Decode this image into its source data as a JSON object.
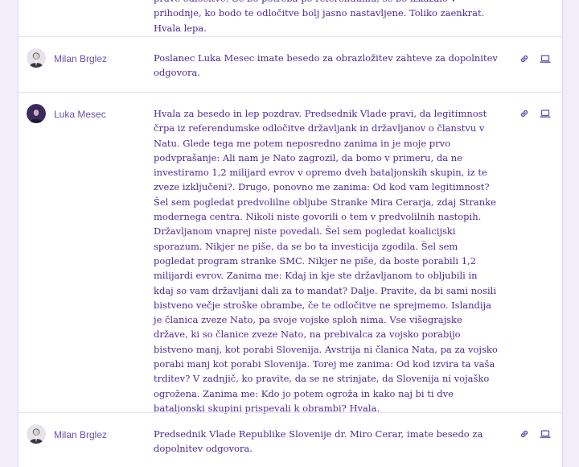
{
  "speeches": [
    {
      "speaker": "",
      "text": "prave odločitve.  Če bo potreba po referendumu, se bo izkazalo v prihodnje, ko bodo te odločitve bolj jasno nastavljene. Toliko zaenkrat. Hvala lepa."
    },
    {
      "speaker": "Milan Brglez",
      "text": "Poslanec Luka Mesec imate besedo za obrazložitev zahteve za dopolnitev odgovora."
    },
    {
      "speaker": "Luka Mesec",
      "text": "Hvala za besedo in lep pozdrav. Predsednik Vlade pravi, da legitimnost črpa iz referendumske odločitve državljank in državljanov o članstvu v Natu.  Glede tega me potem neposredno zanima in je moje prvo podvprašanje:  Ali nam je Nato zagrozil, da bomo v primeru, da ne investiramo 1,2 milijard evrov v opremo dveh bataljonskih skupin, iz te zveze izključeni?. Drugo, ponovno me zanima: Od kod vam legitimnost?  Šel sem pogledat predvolilne obljube Stranke Mira Cerarja, zdaj Stranke modernega centra. Nikoli niste govorili o tem v predvolilnih nastopih. Državljanom vnaprej niste povedali. Šel sem pogledat koalicijski sporazum. Nikjer ne piše, da se bo ta investicija zgodila. Šel sem pogledat program stranke SMC. Nikjer ne piše, da boste porabili 1,2 milijardi evrov. Zanima me:  Kdaj in kje ste državljanom to obljubili in kdaj so vam državljani dali za to mandat? Dalje. Pravite, da bi sami nosili bistveno večje stroške obrambe, če te odločitve ne sprejmemo. Islandija je članica zveze Nato, pa svoje vojske sploh nima. Vse višegrajske države, ki so članice zveze Nato, na prebivalca za vojsko porabijo bistveno manj, kot porabi Slovenija. Avstrija ni članica Nata, pa za vojsko porabi manj kot porabi Slovenija. Torej me zanima: Od kod izvira ta vaša trditev? V zadnjič, ko pravite, da se ne strinjate, da Slovenija ni vojaško ogrožena. Zanima me:  Kdo jo potem ogroža in kako naj bi ti dve bataljonski skupini prispevali k obrambi? Hvala."
    },
    {
      "speaker": "Milan Brglez",
      "text": "Predsednik Vlade Republike Slovenije dr. Miro Cerar, imate besedo za dopolnitev odgovora."
    }
  ],
  "icons": {
    "link": "link-icon",
    "screen": "laptop-icon"
  },
  "colors": {
    "accent": "#6a4fb0",
    "text": "#4b2a95",
    "background": "#f2eef9"
  }
}
